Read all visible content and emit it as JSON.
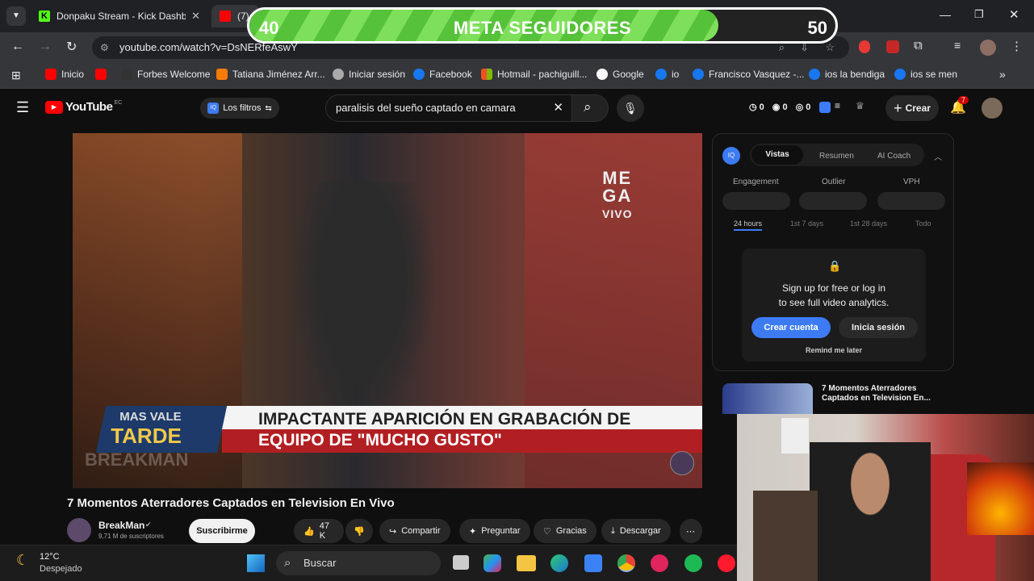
{
  "browser": {
    "tabs": [
      {
        "title": "Donpaku Stream - Kick Dashboard",
        "active": false
      },
      {
        "title": "(7)",
        "active": true
      }
    ],
    "url": "youtube.com/watch?v=DsNERfeAswY",
    "bookmarks": [
      "Inicio",
      "Forbes Welcome",
      "Tatiana Jiménez Arr...",
      "Iniciar sesión",
      "Facebook",
      "Hotmail - pachiguill...",
      "Google",
      "io",
      "Francisco Vasquez -...",
      "ios la bendiga",
      "ios se men"
    ]
  },
  "overlay": {
    "title": "META SEGUIDORES",
    "current": "40",
    "goal": "50",
    "progress_fraction": 0.8
  },
  "youtube": {
    "logo": "YouTube",
    "logo_region": "EC",
    "filters_label": "Los filtros",
    "search_query": "paralisis del sueño captado en camara",
    "counters": [
      "0",
      "0",
      "0"
    ],
    "create_label": "Crear",
    "notifications": "7"
  },
  "video": {
    "channel_logo_line1": "ME",
    "channel_logo_line2": "GA",
    "channel_logo_line3": "VIVO",
    "show_line1": "MAS VALE",
    "show_line2": "TARDE",
    "caption_line1": "IMPACTANTE APARICIÓN EN GRABACIÓN DE",
    "caption_line2": "EQUIPO DE \"MUCHO GUSTO\"",
    "watermark": "BREAKMAN",
    "title": "7 Momentos Aterradores Captados en Television En Vivo",
    "channel": "BreakMan",
    "subscribers": "9,71 M de suscriptores",
    "subscribe_label": "Suscribirme",
    "likes": "47 K",
    "share_label": "Compartir",
    "ask_label": "Preguntar",
    "thanks_label": "Gracias",
    "download_label": "Descargar"
  },
  "panel": {
    "tabs": [
      "Vistas",
      "Resumen",
      "AI Coach"
    ],
    "metrics": [
      "Engagement",
      "Outlier",
      "VPH"
    ],
    "ranges": [
      "24 hours",
      "1st 7 days",
      "1st 28 days",
      "Todo"
    ],
    "signup_line1": "Sign up for free or log in",
    "signup_line2": "to see full video analytics.",
    "create_account": "Crear cuenta",
    "login": "Inicia sesión",
    "remind": "Remind me later"
  },
  "recommended": {
    "title": "7 Momentos Aterradores Captados en Television En..."
  },
  "taskbar": {
    "temperature": "12°C",
    "weather": "Despejado",
    "search_placeholder": "Buscar"
  },
  "colors": {
    "accent_blue": "#3d7bf5",
    "youtube_red": "#ff0000",
    "meta_green": "#56c23a"
  }
}
